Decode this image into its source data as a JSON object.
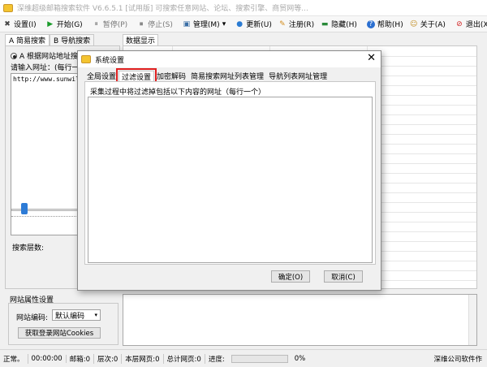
{
  "window": {
    "title": "深维超级邮箱搜索软件 V6.6.5.1 [试用版] 可搜索任意网站、论坛、搜索引擎、商贸网等..."
  },
  "toolbar": {
    "items": [
      {
        "label": "设置(I)",
        "icon": "✖"
      },
      {
        "label": "开始(G)",
        "icon": "▶"
      },
      {
        "label": "暂停(P)",
        "icon": "⏸"
      },
      {
        "label": "停止(S)",
        "icon": "⏹"
      },
      {
        "label": "管理(M)",
        "icon": "▣"
      },
      {
        "label": "更新(U)",
        "icon": "●"
      },
      {
        "label": "注册(R)",
        "icon": "✎"
      },
      {
        "label": "隐藏(H)",
        "icon": "▬"
      },
      {
        "label": "帮助(H)",
        "icon": "?"
      },
      {
        "label": "关于(A)",
        "icon": "☺"
      },
      {
        "label": "退出(X)",
        "icon": "⊘"
      }
    ],
    "dropdown_arrow": "▾"
  },
  "left": {
    "tabs": [
      "A 简易搜索",
      "B 导航搜索"
    ],
    "radio_label": "A 根据网站地址搜索",
    "url_label": "请输入网址：(每行一个)",
    "url_value": "http://www.sunwill.",
    "depth_label": "搜索层数:",
    "depth_level": 0.1
  },
  "properties": {
    "title": "网站属性设置",
    "encoding_label": "网站编码:",
    "encoding_value": "默认编码",
    "cookie_button": "获取登录网站Cookies"
  },
  "data_tab": "数据显示",
  "statusbar": {
    "status": "正常。",
    "time": "00:00:00",
    "mailbox": "邮箱:0",
    "level": "层次:0",
    "page": "本层网页:0",
    "total": "总计网页:0",
    "progress_label": "进度:",
    "progress_percent": "0%",
    "company": "深维公司软件作"
  },
  "dialog": {
    "title": "系统设置",
    "close": "✕",
    "tabs": [
      "全局设置",
      "过滤设置",
      "加密解码",
      "简易搜索网址列表管理",
      "导航列表网址管理"
    ],
    "active_tab": 1,
    "description": "采集过程中将过滤掉包括以下内容的网址（每行一个）",
    "ok_button": "确定(O)",
    "cancel_button": "取消(C)",
    "highlight_color": "#e02020"
  }
}
